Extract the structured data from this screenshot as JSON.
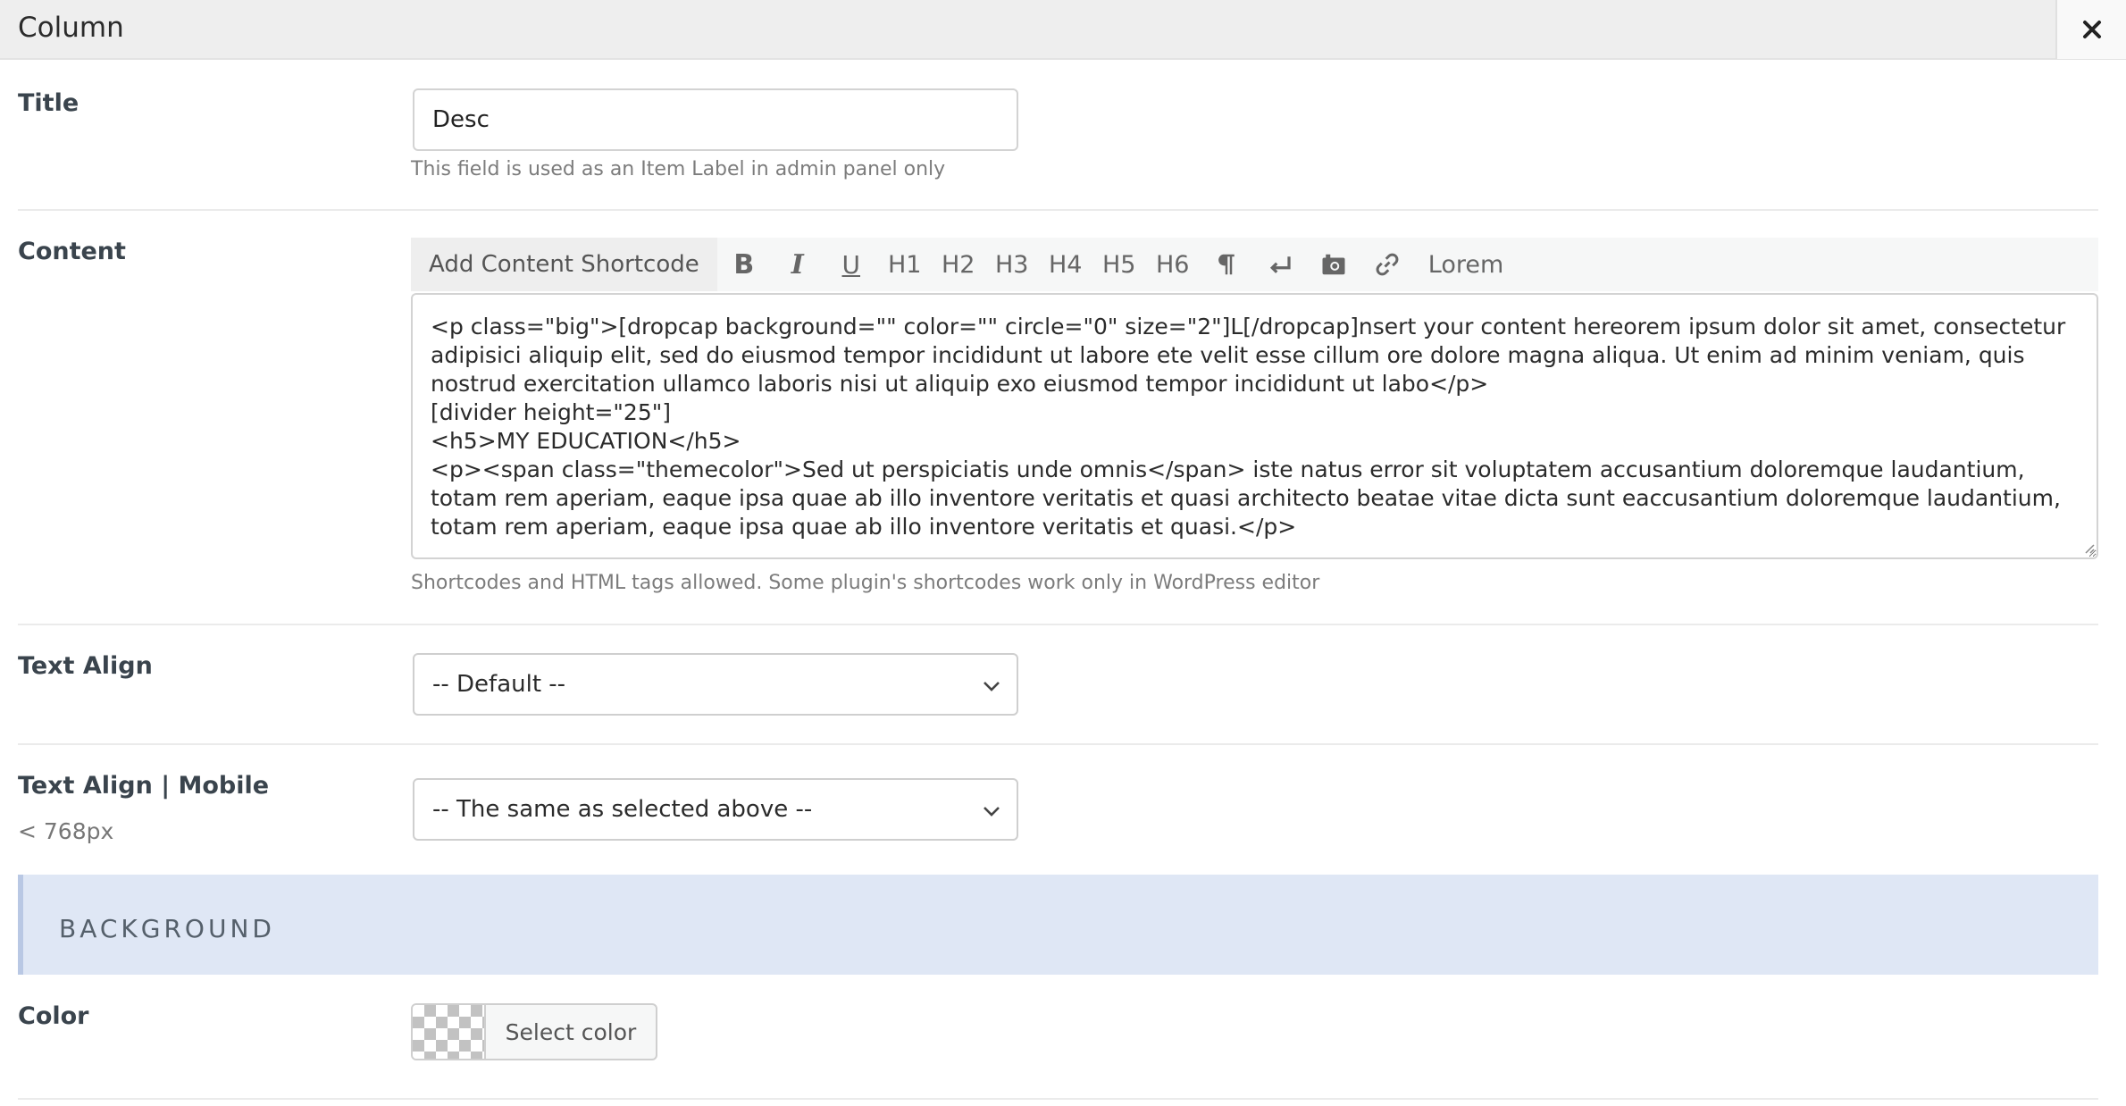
{
  "header": {
    "title": "Column",
    "close_icon": "close-icon"
  },
  "fields": {
    "title": {
      "label": "Title",
      "value": "Desc",
      "description": "This field is used as an Item Label in admin panel only"
    },
    "content": {
      "label": "Content",
      "toolbar": {
        "add_shortcode_label": "Add Content Shortcode",
        "buttons": [
          {
            "name": "bold",
            "label": "B"
          },
          {
            "name": "italic",
            "label": "I"
          },
          {
            "name": "underline",
            "label": "U"
          },
          {
            "name": "h1",
            "label": "H1"
          },
          {
            "name": "h2",
            "label": "H2"
          },
          {
            "name": "h3",
            "label": "H3"
          },
          {
            "name": "h4",
            "label": "H4"
          },
          {
            "name": "h5",
            "label": "H5"
          },
          {
            "name": "h6",
            "label": "H6"
          },
          {
            "name": "paragraph",
            "icon": "pilcrow-icon"
          },
          {
            "name": "line-break",
            "icon": "return-arrow-icon"
          },
          {
            "name": "image",
            "icon": "camera-icon"
          },
          {
            "name": "link",
            "icon": "link-icon"
          },
          {
            "name": "lorem",
            "label": "Lorem"
          }
        ]
      },
      "value": "<p class=\"big\">[dropcap background=\"\" color=\"\" circle=\"0\" size=\"2\"]L[/dropcap]nsert your content hereorem ipsum dolor sit amet, consectetur adipisici aliquip elit, sed do eiusmod tempor incididunt ut labore ete velit esse cillum ore dolore magna aliqua. Ut enim ad minim veniam, quis nostrud exercitation ullamco laboris nisi ut aliquip exo eiusmod tempor incididunt ut labo</p>\n[divider height=\"25\"]\n<h5>MY EDUCATION</h5>\n<p><span class=\"themecolor\">Sed ut perspiciatis unde omnis</span> iste natus error sit voluptatem accusantium doloremque laudantium, totam rem aperiam, eaque ipsa quae ab illo inventore veritatis et quasi architecto beatae vitae dicta sunt eaccusantium doloremque laudantium, totam rem aperiam, eaque ipsa quae ab illo inventore veritatis et quasi.</p>",
      "description": "Shortcodes and HTML tags allowed. Some plugin's shortcodes work only in WordPress editor"
    },
    "text_align": {
      "label": "Text Align",
      "selected": "-- Default --"
    },
    "text_align_mobile": {
      "label": "Text Align | Mobile",
      "sublabel": "< 768px",
      "selected": "-- The same as selected above --"
    }
  },
  "sections": {
    "background": {
      "title": "BACKGROUND",
      "color": {
        "label": "Color",
        "button_label": "Select color"
      }
    }
  },
  "colors": {
    "header_bg": "#eeeeee",
    "section_band_bg": "#dfe7f5",
    "section_band_accent": "#b9c8e4",
    "label_text": "#3a444d"
  }
}
